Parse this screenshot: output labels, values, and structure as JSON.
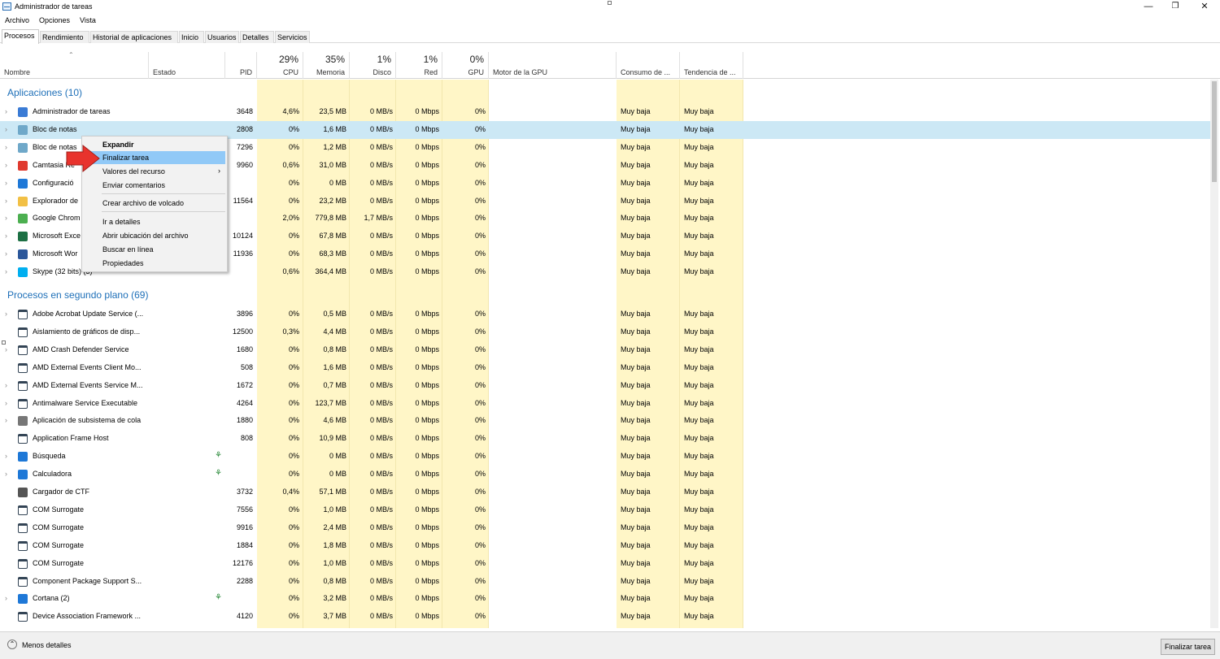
{
  "window": {
    "title": "Administrador de tareas"
  },
  "menu": [
    "Archivo",
    "Opciones",
    "Vista"
  ],
  "tabs": [
    "Procesos",
    "Rendimiento",
    "Historial de aplicaciones",
    "Inicio",
    "Usuarios",
    "Detalles",
    "Servicios"
  ],
  "columns": {
    "nombre": "Nombre",
    "estado": "Estado",
    "pid": "PID",
    "cpu": {
      "pct": "29%",
      "label": "CPU"
    },
    "memoria": {
      "pct": "35%",
      "label": "Memoria"
    },
    "disco": {
      "pct": "1%",
      "label": "Disco"
    },
    "red": {
      "pct": "1%",
      "label": "Red"
    },
    "gpu": {
      "pct": "0%",
      "label": "GPU"
    },
    "motor": "Motor de la GPU",
    "consumo": "Consumo de ...",
    "tendencia": "Tendencia de ..."
  },
  "sections": {
    "apps": "Aplicaciones (10)",
    "bg": "Procesos en segundo plano (69)"
  },
  "apps": [
    {
      "name": "Administrador de tareas",
      "pid": "3648",
      "cpu": "4,6%",
      "mem": "23,5 MB",
      "disk": "0 MB/s",
      "net": "0 Mbps",
      "gpu": "0%",
      "cons": "Muy baja",
      "tend": "Muy baja",
      "icon": "task-manager-icon",
      "color": "#3a7bd5"
    },
    {
      "name": "Bloc de notas",
      "pid": "2808",
      "cpu": "0%",
      "mem": "1,6 MB",
      "disk": "0 MB/s",
      "net": "0 Mbps",
      "gpu": "0%",
      "cons": "Muy baja",
      "tend": "Muy baja",
      "icon": "notepad-icon",
      "color": "#6fa8c9"
    },
    {
      "name": "Bloc de notas",
      "pid": "7296",
      "cpu": "0%",
      "mem": "1,2 MB",
      "disk": "0 MB/s",
      "net": "0 Mbps",
      "gpu": "0%",
      "cons": "Muy baja",
      "tend": "Muy baja",
      "icon": "notepad-icon",
      "color": "#6fa8c9"
    },
    {
      "name": "Camtasia Re",
      "pid": "9960",
      "cpu": "0,6%",
      "mem": "31,0 MB",
      "disk": "0 MB/s",
      "net": "0 Mbps",
      "gpu": "0%",
      "cons": "Muy baja",
      "tend": "Muy baja",
      "icon": "camtasia-icon",
      "color": "#e03a2f"
    },
    {
      "name": "Configuració",
      "pid": "",
      "cpu": "0%",
      "mem": "0 MB",
      "disk": "0 MB/s",
      "net": "0 Mbps",
      "gpu": "0%",
      "cons": "Muy baja",
      "tend": "Muy baja",
      "icon": "settings-icon",
      "color": "#1e78d7"
    },
    {
      "name": "Explorador de",
      "pid": "11564",
      "cpu": "0%",
      "mem": "23,2 MB",
      "disk": "0 MB/s",
      "net": "0 Mbps",
      "gpu": "0%",
      "cons": "Muy baja",
      "tend": "Muy baja",
      "icon": "folder-icon",
      "color": "#f2c045"
    },
    {
      "name": "Google Chrom",
      "pid": "",
      "cpu": "2,0%",
      "mem": "779,8 MB",
      "disk": "1,7 MB/s",
      "net": "0 Mbps",
      "gpu": "0%",
      "cons": "Muy baja",
      "tend": "Muy baja",
      "icon": "chrome-icon",
      "color": "#4caf50"
    },
    {
      "name": "Microsoft Exce",
      "pid": "10124",
      "cpu": "0%",
      "mem": "67,8 MB",
      "disk": "0 MB/s",
      "net": "0 Mbps",
      "gpu": "0%",
      "cons": "Muy baja",
      "tend": "Muy baja",
      "icon": "excel-icon",
      "color": "#1d7044"
    },
    {
      "name": "Microsoft Wor",
      "pid": "11936",
      "cpu": "0%",
      "mem": "68,3 MB",
      "disk": "0 MB/s",
      "net": "0 Mbps",
      "gpu": "0%",
      "cons": "Muy baja",
      "tend": "Muy baja",
      "icon": "word-icon",
      "color": "#2b579a"
    },
    {
      "name": "Skype (32 bits) (3)",
      "pid": "",
      "cpu": "0,6%",
      "mem": "364,4 MB",
      "disk": "0 MB/s",
      "net": "0 Mbps",
      "gpu": "0%",
      "cons": "Muy baja",
      "tend": "Muy baja",
      "icon": "skype-icon",
      "color": "#00aff0"
    }
  ],
  "background": [
    {
      "name": "Adobe Acrobat Update Service (...",
      "pid": "3896",
      "cpu": "0%",
      "mem": "0,5 MB",
      "exp": true,
      "icon": "window-icon",
      "color": "#ffffff",
      "leaf": false
    },
    {
      "name": "Aislamiento de gráficos de disp...",
      "pid": "12500",
      "cpu": "0,3%",
      "mem": "4,4 MB",
      "exp": false,
      "icon": "window-icon",
      "color": "#ffffff",
      "leaf": false
    },
    {
      "name": "AMD Crash Defender Service",
      "pid": "1680",
      "cpu": "0%",
      "mem": "0,8 MB",
      "exp": true,
      "icon": "window-icon",
      "color": "#ffffff",
      "leaf": false
    },
    {
      "name": "AMD External Events Client Mo...",
      "pid": "508",
      "cpu": "0%",
      "mem": "1,6 MB",
      "exp": false,
      "icon": "window-icon",
      "color": "#ffffff",
      "leaf": false
    },
    {
      "name": "AMD External Events Service M...",
      "pid": "1672",
      "cpu": "0%",
      "mem": "0,7 MB",
      "exp": true,
      "icon": "window-icon",
      "color": "#ffffff",
      "leaf": false
    },
    {
      "name": "Antimalware Service Executable",
      "pid": "4264",
      "cpu": "0%",
      "mem": "123,7 MB",
      "exp": true,
      "icon": "window-icon",
      "color": "#ffffff",
      "leaf": false
    },
    {
      "name": "Aplicación de subsistema de cola",
      "pid": "1880",
      "cpu": "0%",
      "mem": "4,6 MB",
      "exp": true,
      "icon": "printer-icon",
      "color": "#777777",
      "leaf": false
    },
    {
      "name": "Application Frame Host",
      "pid": "808",
      "cpu": "0%",
      "mem": "10,9 MB",
      "exp": false,
      "icon": "window-icon",
      "color": "#ffffff",
      "leaf": false
    },
    {
      "name": "Búsqueda",
      "pid": "",
      "cpu": "0%",
      "mem": "0 MB",
      "exp": true,
      "icon": "search-icon",
      "color": "#1e78d7",
      "leaf": true
    },
    {
      "name": "Calculadora",
      "pid": "",
      "cpu": "0%",
      "mem": "0 MB",
      "exp": true,
      "icon": "calculator-icon",
      "color": "#1e78d7",
      "leaf": true
    },
    {
      "name": "Cargador de CTF",
      "pid": "3732",
      "cpu": "0,4%",
      "mem": "57,1 MB",
      "exp": false,
      "icon": "ctf-icon",
      "color": "#555555",
      "leaf": false
    },
    {
      "name": "COM Surrogate",
      "pid": "7556",
      "cpu": "0%",
      "mem": "1,0 MB",
      "exp": false,
      "icon": "window-icon",
      "color": "#ffffff",
      "leaf": false
    },
    {
      "name": "COM Surrogate",
      "pid": "9916",
      "cpu": "0%",
      "mem": "2,4 MB",
      "exp": false,
      "icon": "window-icon",
      "color": "#ffffff",
      "leaf": false
    },
    {
      "name": "COM Surrogate",
      "pid": "1884",
      "cpu": "0%",
      "mem": "1,8 MB",
      "exp": false,
      "icon": "window-icon",
      "color": "#ffffff",
      "leaf": false
    },
    {
      "name": "COM Surrogate",
      "pid": "12176",
      "cpu": "0%",
      "mem": "1,0 MB",
      "exp": false,
      "icon": "window-icon",
      "color": "#ffffff",
      "leaf": false
    },
    {
      "name": "Component Package Support S...",
      "pid": "2288",
      "cpu": "0%",
      "mem": "0,8 MB",
      "exp": false,
      "icon": "window-icon",
      "color": "#ffffff",
      "leaf": false
    },
    {
      "name": "Cortana (2)",
      "pid": "",
      "cpu": "0%",
      "mem": "3,2 MB",
      "exp": true,
      "icon": "cortana-icon",
      "color": "#1e78d7",
      "leaf": true
    },
    {
      "name": "Device Association Framework ...",
      "pid": "4120",
      "cpu": "0%",
      "mem": "3,7 MB",
      "exp": false,
      "icon": "window-icon",
      "color": "#ffffff",
      "leaf": false
    }
  ],
  "bg_common": {
    "disk": "0 MB/s",
    "net": "0 Mbps",
    "gpu": "0%",
    "cons": "Muy baja",
    "tend": "Muy baja"
  },
  "context_menu": {
    "items": [
      "Expandir",
      "Finalizar tarea",
      "Valores del recurso",
      "Enviar comentarios",
      "Crear archivo de volcado",
      "Ir a detalles",
      "Abrir ubicación del archivo",
      "Buscar en línea",
      "Propiedades"
    ],
    "highlighted": "Finalizar tarea"
  },
  "footer": {
    "less": "Menos detalles",
    "end_task": "Finalizar tarea"
  },
  "colors": {
    "accent": "#1d6fb8",
    "heat": "#fff6c7",
    "selection": "#cce8f5",
    "menu_highlight": "#91c9f7",
    "arrow": "#e8332d"
  }
}
